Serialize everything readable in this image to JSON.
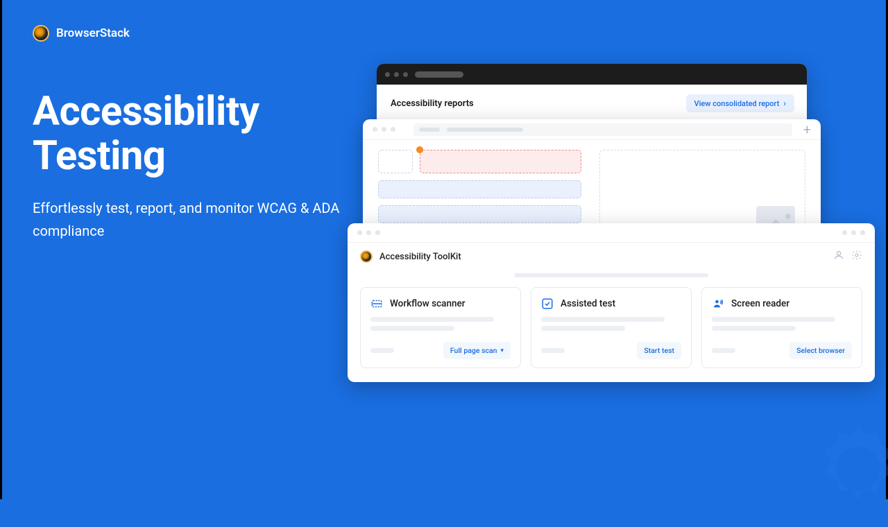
{
  "brand": {
    "name": "BrowserStack"
  },
  "hero": {
    "title": "Accessibility Testing",
    "subtitle": "Effortlessly test, report, and monitor WCAG & ADA compliance"
  },
  "back_window": {
    "title": "Accessibility reports",
    "view_button": "View consolidated report"
  },
  "front_window": {
    "title": "Accessibility ToolKit"
  },
  "cards": [
    {
      "title": "Workflow scanner",
      "button": "Full page scan",
      "has_chevron": true
    },
    {
      "title": "Assisted test",
      "button": "Start test",
      "has_chevron": false
    },
    {
      "title": "Screen reader",
      "button": "Select browser",
      "has_chevron": false
    }
  ]
}
